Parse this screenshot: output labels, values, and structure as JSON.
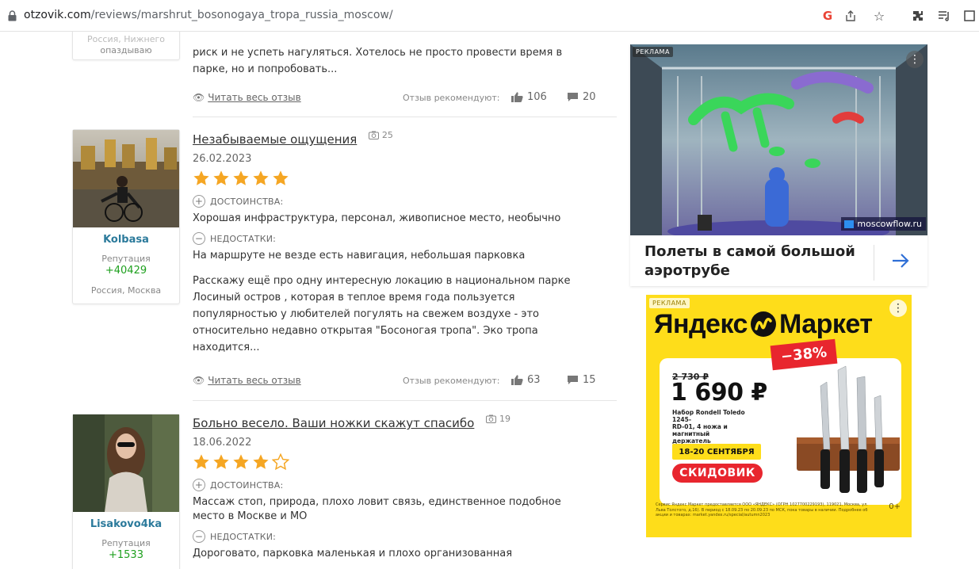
{
  "browser": {
    "url_domain": "otzovik.com",
    "url_path": "/reviews/marshrut_bosonogaya_tropa_russia_moscow/"
  },
  "reviews": [
    {
      "partial_user_text_line1": "Россия, Нижнего",
      "partial_user_text_line2": "опаздываю",
      "body_line1": "риск и не успеть нагуляться. Хотелось не просто провести время в",
      "body_line2": "парке, но и попробовать...",
      "read_full": "Читать весь отзыв",
      "recommend_label": "Отзыв рекомендуют:",
      "likes": "106",
      "comments": "20"
    },
    {
      "user_name": "Kolbasa",
      "reputation_label": "Репутация",
      "reputation": "+40429",
      "location": "Россия, Москва",
      "title": "Незабываемые ощущения",
      "photo_count": "25",
      "date": "26.02.2023",
      "rating": 5,
      "pros_label": "ДОСТОИНСТВА:",
      "pros": "Хорошая инфраструктура, персонал, живописное место, необычно",
      "cons_label": "НЕДОСТАТКИ:",
      "cons": "На маршруте не везде есть навигация, небольшая парковка",
      "body_line1": "Расскажу ещё про одну интересную локацию в национальном парке",
      "body_line2": "Лосиный остров , которая в теплое время года пользуется",
      "body_line3": "популярностью у любителей погулять на свежем воздухе - это",
      "body_line4": "относительно недавно открытая \"Босоногая тропа\". Эко тропа",
      "body_line5": "находится...",
      "read_full": "Читать весь отзыв",
      "recommend_label": "Отзыв рекомендуют:",
      "likes": "63",
      "comments": "15"
    },
    {
      "user_name": "Lisakovo4ka",
      "reputation_label": "Репутация",
      "reputation": "+1533",
      "title": "Больно весело. Ваши ножки скажут спасибо",
      "photo_count": "19",
      "date": "18.06.2022",
      "rating": 4,
      "pros_label": "ДОСТОИНСТВА:",
      "pros_line1": "Массаж стоп, природа, плохо ловит связь, единственное подобное",
      "pros_line2": "место в Москве и МО",
      "cons_label": "НЕДОСТАТКИ:",
      "cons": "Дороговато, парковка маленькая и плохо организованная"
    }
  ],
  "ads": {
    "ad1": {
      "badge": "РЕКЛАМА",
      "domain": "moscowflow.ru",
      "title_line1": "Полеты в самой большой",
      "title_line2": "аэротрубе"
    },
    "ad2": {
      "badge": "РЕКЛАМА",
      "brand_left": "Яндекс",
      "brand_right": "Маркет",
      "discount": "−38%",
      "old_price": "2 730 ₽",
      "new_price": "1 690 ₽",
      "product_line1": "Набор Rondell Toledo 1245-",
      "product_line2": "RD-01, 4 ножа и магнитный",
      "product_line3": "держатель",
      "dates": "18-20 СЕНТЯБРЯ",
      "promo": "СКИДОВИК",
      "legal": "Сервис Яндекс Маркет предоставляется ООО «ЯНДЕКС» (ОГРН 1027700229193), 119021, Москва, ул. Льва Толстого, д.16). В период с 18.09.23 по 20.09.23 по МСК, пока товары в наличии. Подробнее об акции и товарах: market.yandex.ru/special/autumn2023",
      "age": "0+"
    }
  },
  "colors": {
    "star": "#f5a623",
    "link_blue": "#2b7a9b",
    "reputation_green": "#1ea01e",
    "ym_yellow": "#fedd1a",
    "sale_red": "#e8262e"
  }
}
